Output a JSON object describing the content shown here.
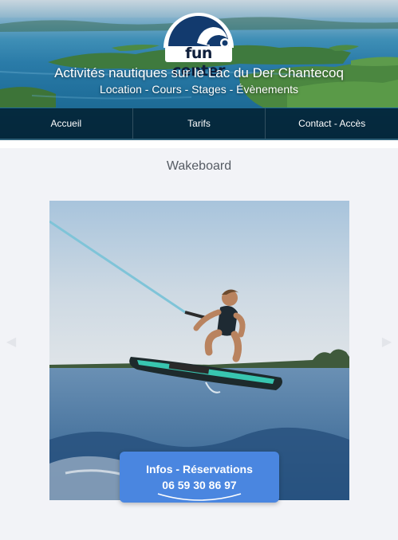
{
  "header": {
    "logo_text": "fun center",
    "headline": "Activités nautiques sur le Lac du Der Chantecoq",
    "subline": "Location - Cours - Stages - Évènements"
  },
  "nav": {
    "items": [
      {
        "label": "Accueil"
      },
      {
        "label": "Tarifs"
      },
      {
        "label": "Contact - Accès"
      }
    ]
  },
  "main": {
    "title": "Wakeboard",
    "photo_icon": "wakeboard-photo",
    "carousel": {
      "prev_icon": "chevron-left-icon",
      "next_icon": "chevron-right-icon"
    }
  },
  "cta": {
    "title": "Infos - Réservations",
    "phone": "06 59 30 86 97"
  },
  "colors": {
    "nav_bg": "#001c2c",
    "cta_bg": "#4a86e0",
    "page_bg": "#f2f3f7",
    "title_text": "#555b63"
  }
}
